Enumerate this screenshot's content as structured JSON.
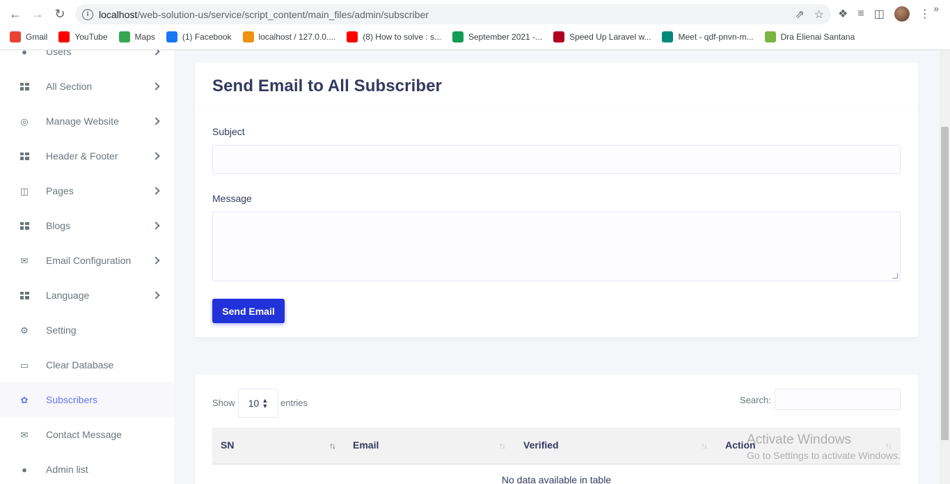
{
  "browser": {
    "url_host": "localhost",
    "url_path": "/web-solution-us/service/script_content/main_files/admin/subscriber",
    "bookmarks": [
      {
        "label": "Gmail",
        "icon": "gmail-icon",
        "color": "#ea4335"
      },
      {
        "label": "YouTube",
        "icon": "youtube-icon",
        "color": "#ff0000"
      },
      {
        "label": "Maps",
        "icon": "maps-icon",
        "color": "#34a853"
      },
      {
        "label": "(1) Facebook",
        "icon": "facebook-icon",
        "color": "#1877f2"
      },
      {
        "label": "localhost / 127.0.0....",
        "icon": "phpmyadmin-icon",
        "color": "#f29111"
      },
      {
        "label": "(8) How to solve : s...",
        "icon": "youtube-icon",
        "color": "#ff0000"
      },
      {
        "label": "September 2021 -...",
        "icon": "sheets-icon",
        "color": "#0f9d58"
      },
      {
        "label": "Speed Up Laravel w...",
        "icon": "laravel-icon",
        "color": "#b00020"
      },
      {
        "label": "Meet - qdf-pnvn-m...",
        "icon": "meet-icon",
        "color": "#00897b"
      },
      {
        "label": "Dra Elienai Santana",
        "icon": "site-icon",
        "color": "#7cb342"
      }
    ]
  },
  "sidebar": {
    "items": [
      {
        "label": "Users",
        "icon": "users-icon",
        "chevron": true
      },
      {
        "label": "All Section",
        "icon": "grid-icon",
        "chevron": true
      },
      {
        "label": "Manage Website",
        "icon": "globe-icon",
        "chevron": true
      },
      {
        "label": "Header & Footer",
        "icon": "grid-icon",
        "chevron": true
      },
      {
        "label": "Pages",
        "icon": "columns-icon",
        "chevron": true
      },
      {
        "label": "Blogs",
        "icon": "grid-icon",
        "chevron": true
      },
      {
        "label": "Email Configuration",
        "icon": "envelope-icon",
        "chevron": true
      },
      {
        "label": "Language",
        "icon": "grid-icon",
        "chevron": true
      },
      {
        "label": "Setting",
        "icon": "gear-icon",
        "chevron": false
      },
      {
        "label": "Clear Database",
        "icon": "trash-icon",
        "chevron": false
      },
      {
        "label": "Subscribers",
        "icon": "fire-icon",
        "chevron": false,
        "active": true
      },
      {
        "label": "Contact Message",
        "icon": "envelope-icon",
        "chevron": false
      },
      {
        "label": "Admin list",
        "icon": "user-icon",
        "chevron": false
      }
    ]
  },
  "email_form": {
    "title": "Send Email to All Subscriber",
    "subject_label": "Subject",
    "subject_value": "",
    "message_label": "Message",
    "message_value": "",
    "send_label": "Send Email"
  },
  "table": {
    "show_label": "Show",
    "entries_value": "10",
    "entries_label": "entries",
    "search_label": "Search:",
    "columns": [
      "SN",
      "Email",
      "Verified",
      "Action"
    ],
    "empty_text": "No data available in table"
  },
  "watermark": {
    "line1": "Activate Windows",
    "line2": "Go to Settings to activate Windows."
  },
  "colors": {
    "accent": "#6777ef",
    "button": "#2232d9"
  }
}
